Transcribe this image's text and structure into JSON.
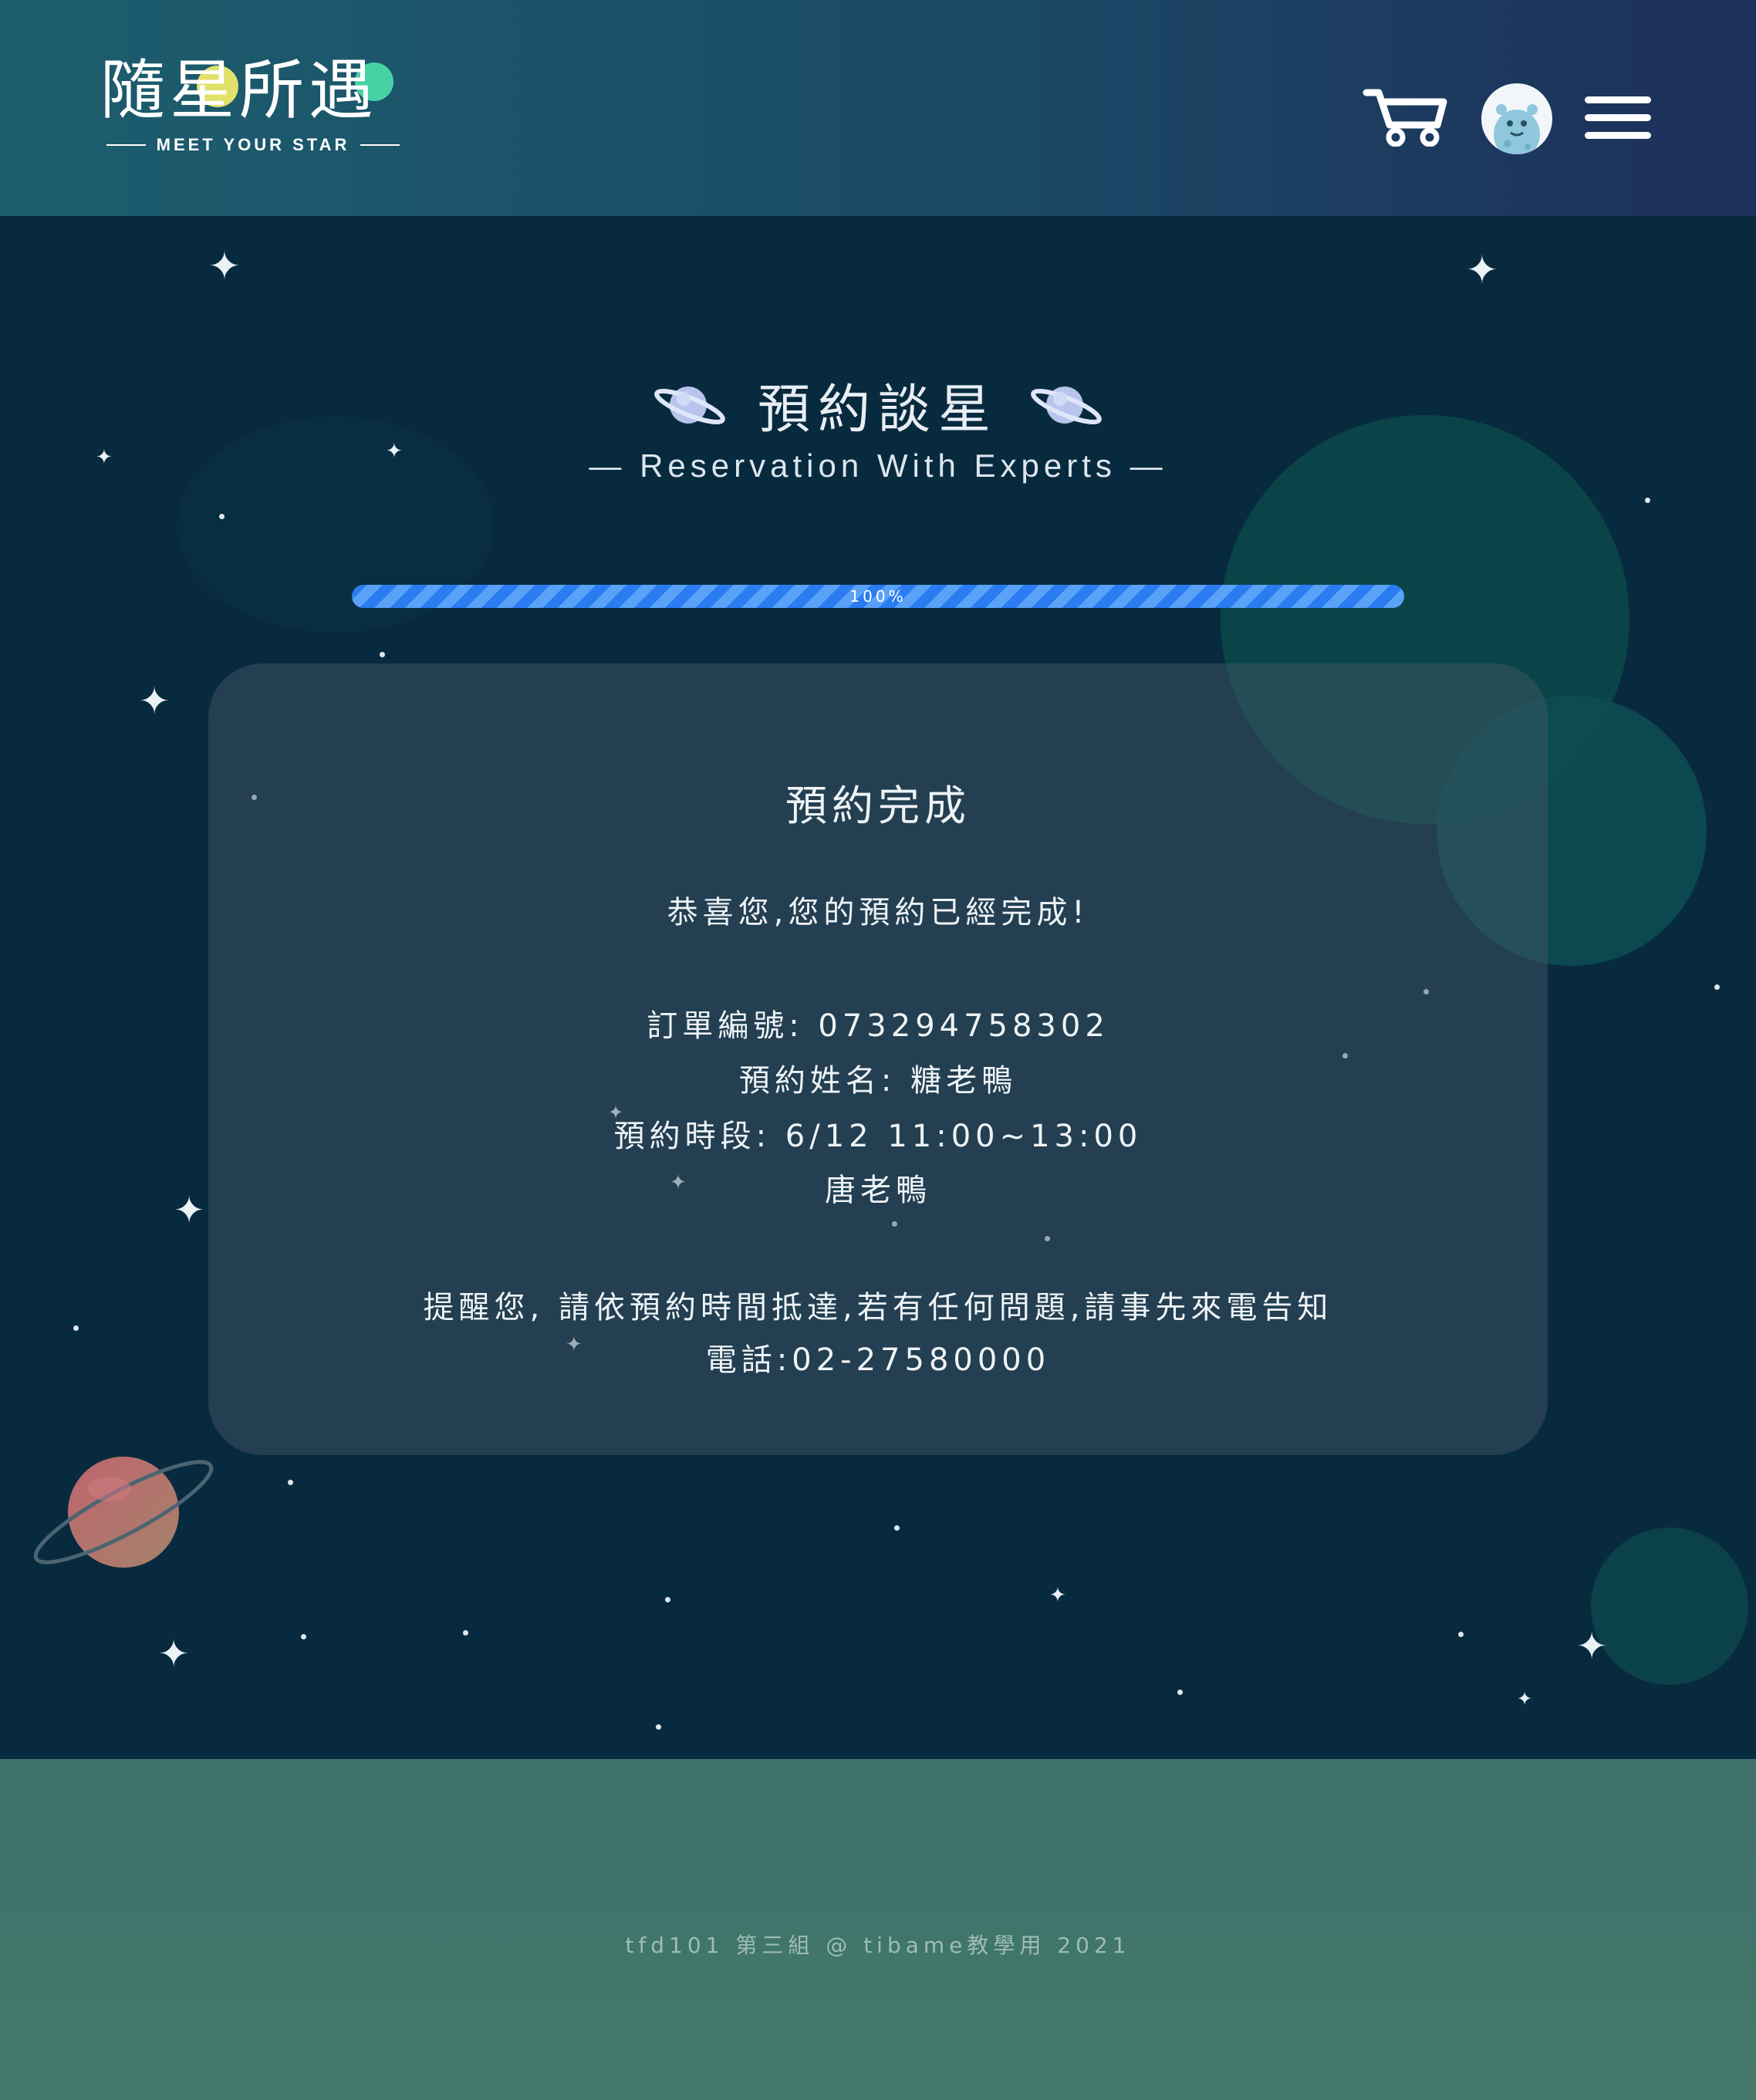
{
  "header": {
    "logo_title": "隨星所遇",
    "logo_subtitle": "MEET YOUR STAR",
    "icons": [
      "cart-icon",
      "user-avatar",
      "hamburger-menu-icon"
    ]
  },
  "page": {
    "title": "預約談星",
    "subtitle": "— Reservation With Experts —"
  },
  "progress": {
    "value": 1.0,
    "label": "100%"
  },
  "confirmation": {
    "heading": "預約完成",
    "message": "恭喜您,您的預約已經完成!",
    "order_number": "訂單編號: 073294758302",
    "reservation_name": "預約姓名: 糖老鴨",
    "time_slot": "預約時段: 6/12 11:00~13:00",
    "expert": "唐老鴨",
    "reminder": "提醒您, 請依預約時間抵達,若有任何問題,請事先來電告知",
    "phone": "電話:02-27580000"
  },
  "footer": {
    "text": "tfd101 第三組 @ tibame教學用 2021"
  },
  "colors": {
    "header_start": "#1c5e6e",
    "header_end": "#1d2f5a",
    "background": "#082a3e",
    "progress": "#2a7cf0",
    "footer": "#3d716a"
  }
}
